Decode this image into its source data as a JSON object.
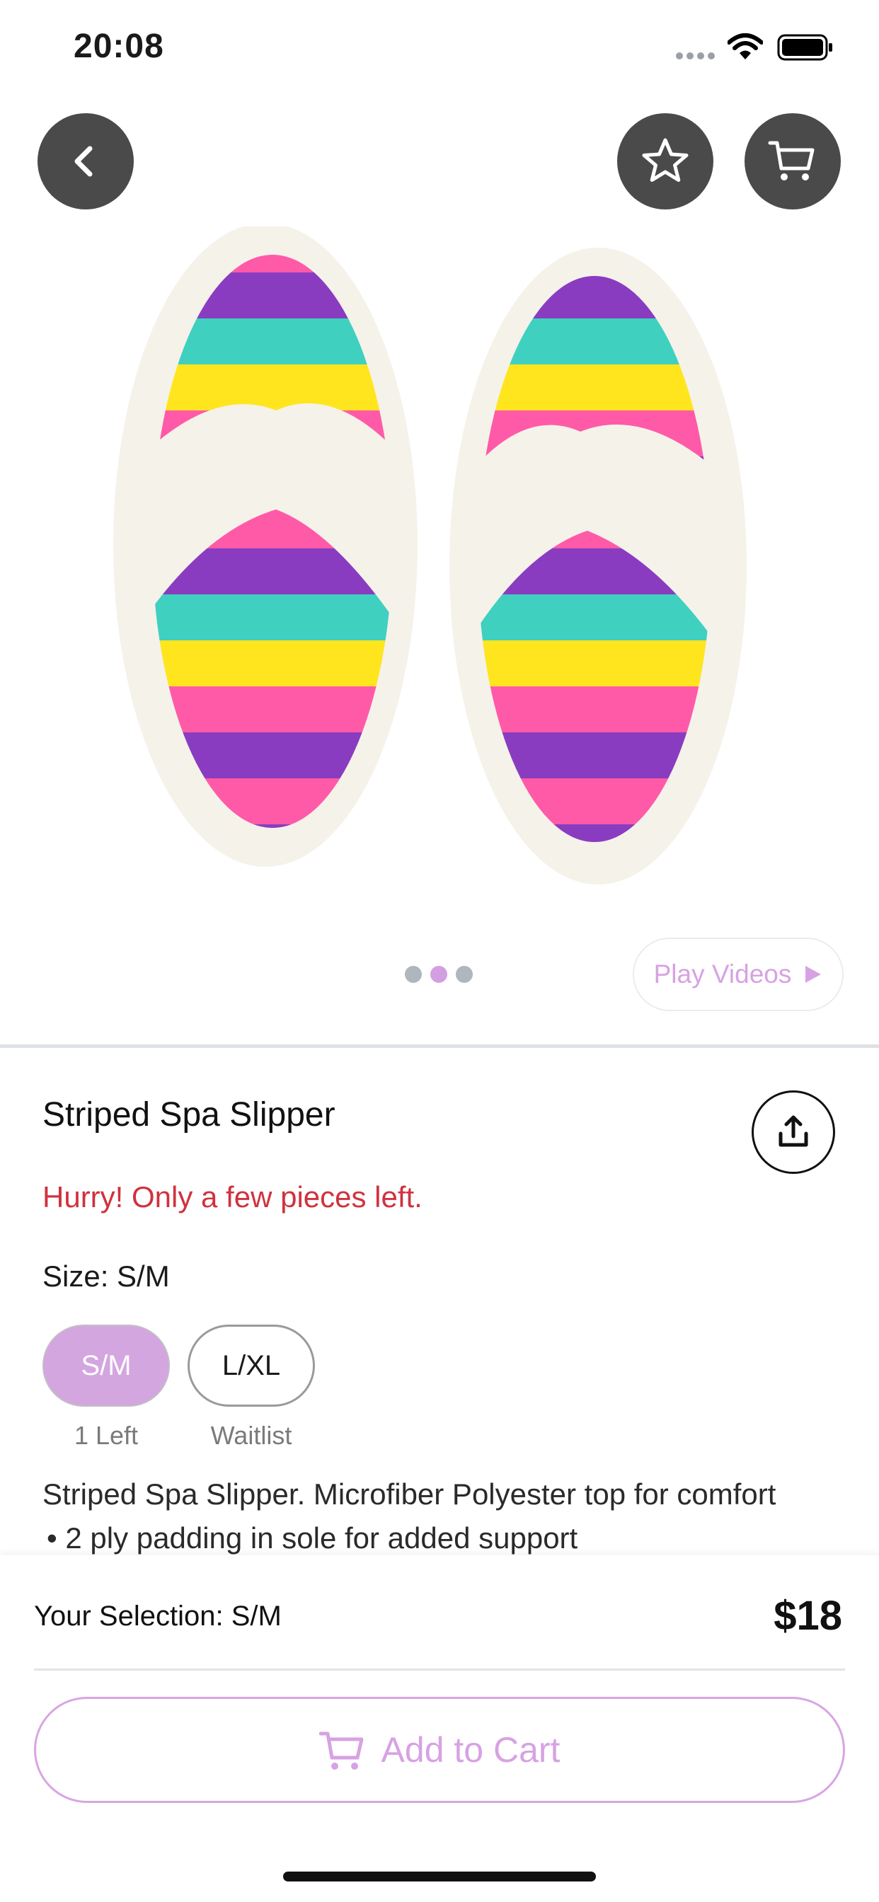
{
  "status_bar": {
    "time": "20:08"
  },
  "header": {
    "back_icon": "chevron-left-icon",
    "favorite_icon": "star-icon",
    "cart_icon": "cart-icon"
  },
  "gallery": {
    "dot_count": 3,
    "active_dot": 2,
    "play_videos_label": "Play Videos"
  },
  "product": {
    "title": "Striped Spa Slipper",
    "stock_warning": "Hurry! Only a few pieces left.",
    "size_label": "Size: S/M",
    "sizes": [
      {
        "label": "S/M",
        "status": "1 Left",
        "selected": true
      },
      {
        "label": "L/XL",
        "status": "Waitlist",
        "selected": false
      }
    ],
    "description_line1": "Striped Spa Slipper. Microfiber Polyester top for comfort",
    "description_line2": "• 2 ply padding in sole for added support"
  },
  "footer": {
    "selection": "Your Selection: S/M",
    "price": "$18",
    "add_to_cart_label": "Add to Cart"
  },
  "colors": {
    "accent": "#d7a2e3",
    "warning": "#d0323e",
    "button_dark": "#4a4a4a"
  }
}
